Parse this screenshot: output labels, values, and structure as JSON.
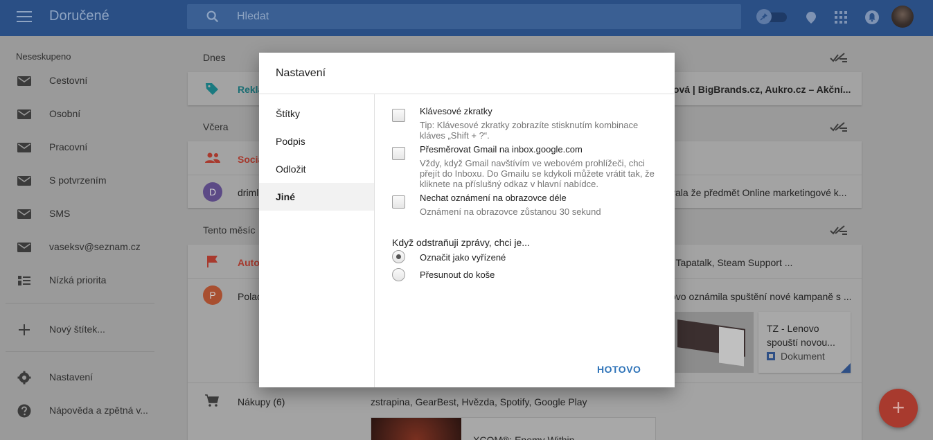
{
  "topbar": {
    "title": "Doručené",
    "search_placeholder": "Hledat"
  },
  "sidebar": {
    "header": "Neseskupeno",
    "items": [
      {
        "label": "Cestovní",
        "icon": "mail-icon"
      },
      {
        "label": "Osobní",
        "icon": "mail-icon"
      },
      {
        "label": "Pracovní",
        "icon": "mail-icon"
      },
      {
        "label": "S potvrzením",
        "icon": "mail-icon"
      },
      {
        "label": "SMS",
        "icon": "mail-icon"
      },
      {
        "label": "vaseksv@seznam.cz",
        "icon": "mail-icon"
      },
      {
        "label": "Nízká priorita",
        "icon": "low-priority-icon"
      }
    ],
    "new_label": "Nový štítek...",
    "settings": "Nastavení",
    "help": "Nápověda a zpětná v..."
  },
  "main": {
    "days": [
      "Dnes",
      "Včera",
      "Tento měsíc"
    ],
    "rows": {
      "reklamy_label": "Reklamy",
      "reklamy_senders": "lová | BigBrands.cz, Aukro.cz – Akční...",
      "social_label": "Sociální",
      "drimla_avatar": "D",
      "drimla_sender": "drimla",
      "drimla_snippet": "vala že předmět Online marketingové k...",
      "auto_label": "Automaticky",
      "auto_senders": ", Tapatalk, Steam Support ...",
      "pola_avatar": "P",
      "pola_sender": "Polac",
      "pola_snippet": "ovo oznámila spuštění nové kampaně s ...",
      "attachment_title": "TZ - Lenovo spouští novou...",
      "attachment_type": "Dokument",
      "nakupy_label": "Nákupy (6)",
      "nakupy_senders": "zstrapina, GearBest, Hvězda, Spotify, Google Play",
      "xcom": "XCOM®: Enemy Within"
    }
  },
  "dialog": {
    "title": "Nastavení",
    "nav": [
      "Štítky",
      "Podpis",
      "Odložit",
      "Jiné"
    ],
    "active_nav": "Jiné",
    "options": [
      {
        "title": "Klávesové zkratky",
        "desc": "Tip: Klávesové zkratky zobrazíte stisknutím kombinace kláves „Shift + ?“.",
        "checked": false
      },
      {
        "title": "Přesměrovat Gmail na inbox.google.com",
        "desc": "Vždy, když Gmail navštívím ve webovém prohlížeči, chci přejít do Inboxu. Do Gmailu se kdykoli můžete vrátit tak, že kliknete na příslušný odkaz v hlavní nabídce.",
        "checked": false
      },
      {
        "title": "Nechat oznámení na obrazovce déle",
        "desc": "Oznámení na obrazovce zůstanou 30 sekund",
        "checked": false
      }
    ],
    "delete_label": "Když odstraňuji zprávy, chci je...",
    "radio_options": [
      {
        "label": "Označit jako vyřízené",
        "selected": true
      },
      {
        "label": "Přesunout do koše",
        "selected": false
      }
    ],
    "done_label": "HOTOVO"
  },
  "fab_label": "+",
  "colors": {
    "topbar": "#2a4f85",
    "accent_link": "#2e73b8",
    "fab": "#a83a2e"
  }
}
